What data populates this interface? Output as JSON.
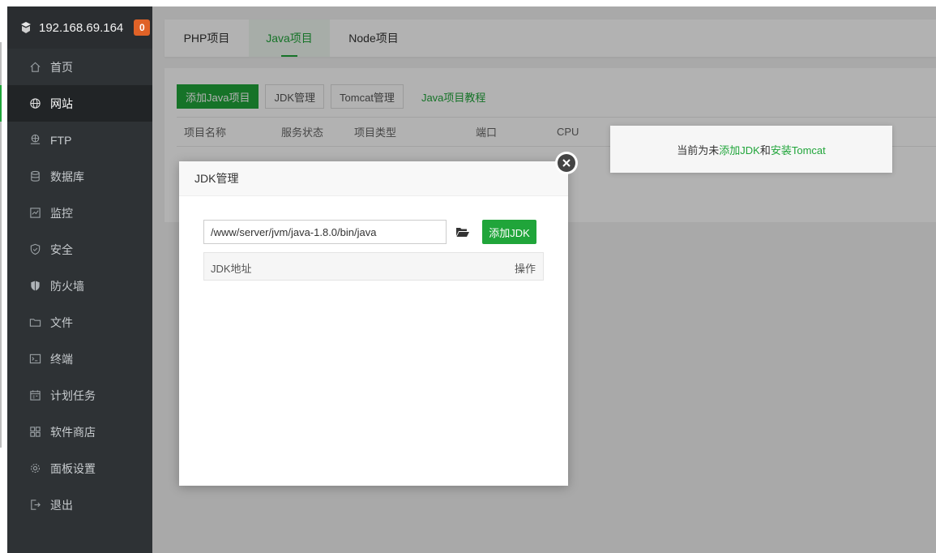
{
  "sidebar": {
    "server_ip": "192.168.69.164",
    "badge": "0",
    "items": [
      {
        "label": "首页",
        "icon": "home-icon"
      },
      {
        "label": "网站",
        "icon": "globe-icon",
        "active": true
      },
      {
        "label": "FTP",
        "icon": "ftp-icon"
      },
      {
        "label": "数据库",
        "icon": "database-icon"
      },
      {
        "label": "监控",
        "icon": "monitor-icon"
      },
      {
        "label": "安全",
        "icon": "shield-icon"
      },
      {
        "label": "防火墙",
        "icon": "firewall-icon"
      },
      {
        "label": "文件",
        "icon": "folder-icon"
      },
      {
        "label": "终端",
        "icon": "terminal-icon"
      },
      {
        "label": "计划任务",
        "icon": "calendar-icon"
      },
      {
        "label": "软件商店",
        "icon": "apps-icon"
      },
      {
        "label": "面板设置",
        "icon": "gear-icon"
      },
      {
        "label": "退出",
        "icon": "logout-icon"
      }
    ]
  },
  "tabs": {
    "php": "PHP项目",
    "java": "Java项目",
    "node": "Node项目",
    "active": "java"
  },
  "toolbar": {
    "add_java": "添加Java项目",
    "jdk_manage": "JDK管理",
    "tomcat_manage": "Tomcat管理",
    "tutorial": "Java项目教程"
  },
  "project_table": {
    "columns": [
      "项目名称",
      "服务状态",
      "项目类型",
      "端口",
      "CPU"
    ]
  },
  "tip": {
    "prefix": "当前为未",
    "add_jdk": "添加JDK",
    "mid": "和",
    "install_tomcat": "安装Tomcat"
  },
  "modal": {
    "title": "JDK管理",
    "path_value": "/www/server/jvm/java-1.8.0/bin/java",
    "add_button": "添加JDK",
    "col_address": "JDK地址",
    "col_action": "操作"
  },
  "colors": {
    "accent": "#20a53a",
    "sidebar_bg": "#2e3235",
    "badge": "#e06227"
  }
}
